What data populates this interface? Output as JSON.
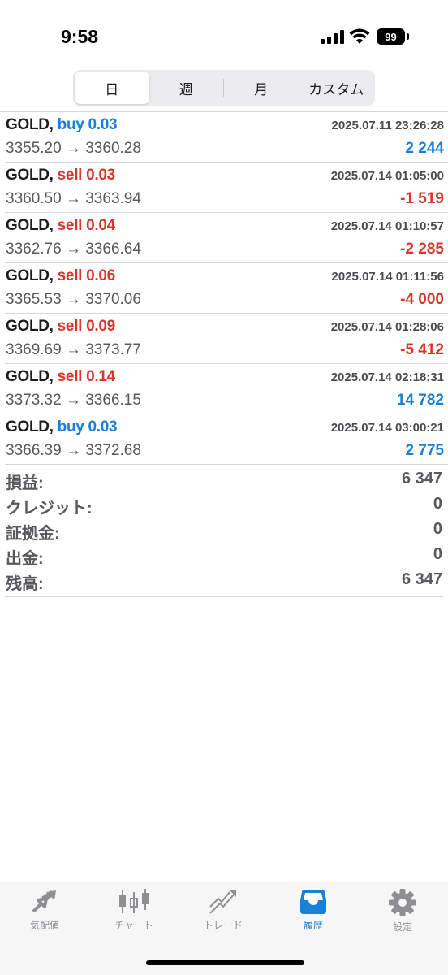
{
  "status_bar": {
    "time": "9:58",
    "battery": "99"
  },
  "period_tabs": [
    {
      "label": "日",
      "active": true
    },
    {
      "label": "週",
      "active": false
    },
    {
      "label": "月",
      "active": false
    },
    {
      "label": "カスタム",
      "active": false
    }
  ],
  "trades": [
    {
      "symbol": "GOLD,",
      "side": "buy 0.03",
      "direction": "buy",
      "time": "2025.07.11 23:26:28",
      "prices": "3355.20 → 3360.28",
      "profit": "2 244",
      "profit_sign": "pos"
    },
    {
      "symbol": "GOLD,",
      "side": "sell 0.03",
      "direction": "sell",
      "time": "2025.07.14 01:05:00",
      "prices": "3360.50 → 3363.94",
      "profit": "-1 519",
      "profit_sign": "neg"
    },
    {
      "symbol": "GOLD,",
      "side": "sell 0.04",
      "direction": "sell",
      "time": "2025.07.14 01:10:57",
      "prices": "3362.76 → 3366.64",
      "profit": "-2 285",
      "profit_sign": "neg"
    },
    {
      "symbol": "GOLD,",
      "side": "sell 0.06",
      "direction": "sell",
      "time": "2025.07.14 01:11:56",
      "prices": "3365.53 → 3370.06",
      "profit": "-4 000",
      "profit_sign": "neg"
    },
    {
      "symbol": "GOLD,",
      "side": "sell 0.09",
      "direction": "sell",
      "time": "2025.07.14 01:28:06",
      "prices": "3369.69 → 3373.77",
      "profit": "-5 412",
      "profit_sign": "neg"
    },
    {
      "symbol": "GOLD,",
      "side": "sell 0.14",
      "direction": "sell",
      "time": "2025.07.14 02:18:31",
      "prices": "3373.32 → 3366.15",
      "profit": "14 782",
      "profit_sign": "pos"
    },
    {
      "symbol": "GOLD,",
      "side": "buy 0.03",
      "direction": "buy",
      "time": "2025.07.14 03:00:21",
      "prices": "3366.39 → 3372.68",
      "profit": "2 775",
      "profit_sign": "pos"
    }
  ],
  "summary": [
    {
      "label": "損益:",
      "value": "6 347"
    },
    {
      "label": "クレジット:",
      "value": "0"
    },
    {
      "label": "証拠金:",
      "value": "0"
    },
    {
      "label": "出金:",
      "value": "0"
    },
    {
      "label": "残高:",
      "value": "6 347"
    }
  ],
  "tabbar": [
    {
      "label": "気配値",
      "icon": "quotes-icon",
      "active": false
    },
    {
      "label": "チャート",
      "icon": "candlestick-icon",
      "active": false
    },
    {
      "label": "トレード",
      "icon": "trade-icon",
      "active": false
    },
    {
      "label": "履歴",
      "icon": "inbox-icon",
      "active": true
    },
    {
      "label": "設定",
      "icon": "gear-icon",
      "active": false
    }
  ],
  "colors": {
    "buy": "#1a7fd6",
    "sell": "#d9352b",
    "active_tab": "#1a7fd6",
    "inactive_tab": "#8e8e93"
  }
}
